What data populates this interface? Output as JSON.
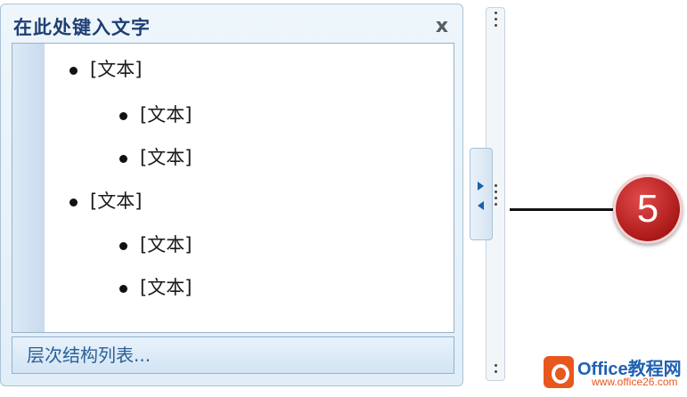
{
  "pane": {
    "title": "在此处键入文字",
    "close_label": "x"
  },
  "outline": [
    {
      "text": "[文本]",
      "level": 1
    },
    {
      "text": "[文本]",
      "level": 2
    },
    {
      "text": "[文本]",
      "level": 2
    },
    {
      "text": "[文本]",
      "level": 1
    },
    {
      "text": "[文本]",
      "level": 2
    },
    {
      "text": "[文本]",
      "level": 2
    }
  ],
  "footer": {
    "layout_name": "层次结构列表..."
  },
  "callout": {
    "number": "5"
  },
  "watermark": {
    "text": "Office教程网",
    "url": "www.office26.com"
  },
  "colors": {
    "title": "#1f3f74",
    "footer_text": "#2b5f97",
    "badge": "#c62020",
    "watermark_orange": "#e8571d",
    "watermark_blue": "#2061b3"
  }
}
